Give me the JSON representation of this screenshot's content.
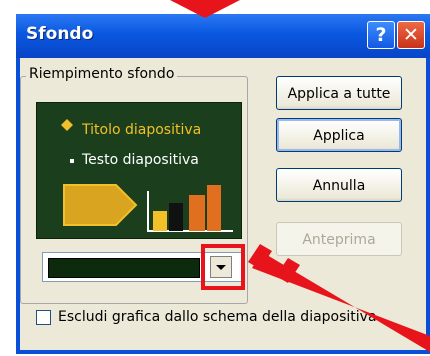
{
  "window": {
    "title": "Sfondo",
    "help_icon": "help-icon",
    "close_icon": "close-icon"
  },
  "background_fill": {
    "group_label": "Riempimento sfondo",
    "preview": {
      "title_text": "Titolo diapositiva",
      "body_text": "Testo diapositiva",
      "background_color": "#1b3f1c",
      "title_color": "#f2c028"
    },
    "color_dropdown": {
      "selected_color": "#0c2a0c",
      "arrow_icon": "dropdown-arrow-icon"
    }
  },
  "buttons": {
    "apply_all": "Applica a tutte",
    "apply": "Applica",
    "cancel": "Annulla",
    "preview": "Anteprima"
  },
  "checkbox": {
    "label": "Escludi grafica dallo schema della diapositiva",
    "checked": false
  },
  "annotation": {
    "highlight_color": "#e8141b",
    "shapes": [
      "highlight-box",
      "pointer-arrow"
    ]
  }
}
